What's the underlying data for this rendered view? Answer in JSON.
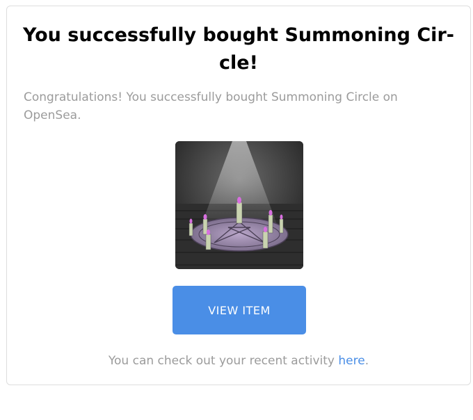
{
  "email": {
    "title": "You successfully bought Summoning Cir-cle!",
    "message": "Congratulations! You successfully bought Summoning Circle on OpenSea.",
    "view_button_label": "VIEW ITEM",
    "footer_prefix": "You can check out your recent activity ",
    "footer_link": "here",
    "footer_suffix": "."
  },
  "item": {
    "name": "Summoning Circle",
    "image_icon": "summoning-circle-image"
  },
  "colors": {
    "button": "#4a8ee6",
    "link": "#4a8ee6",
    "muted_text": "#9b9b9b",
    "title_text": "#000000"
  }
}
